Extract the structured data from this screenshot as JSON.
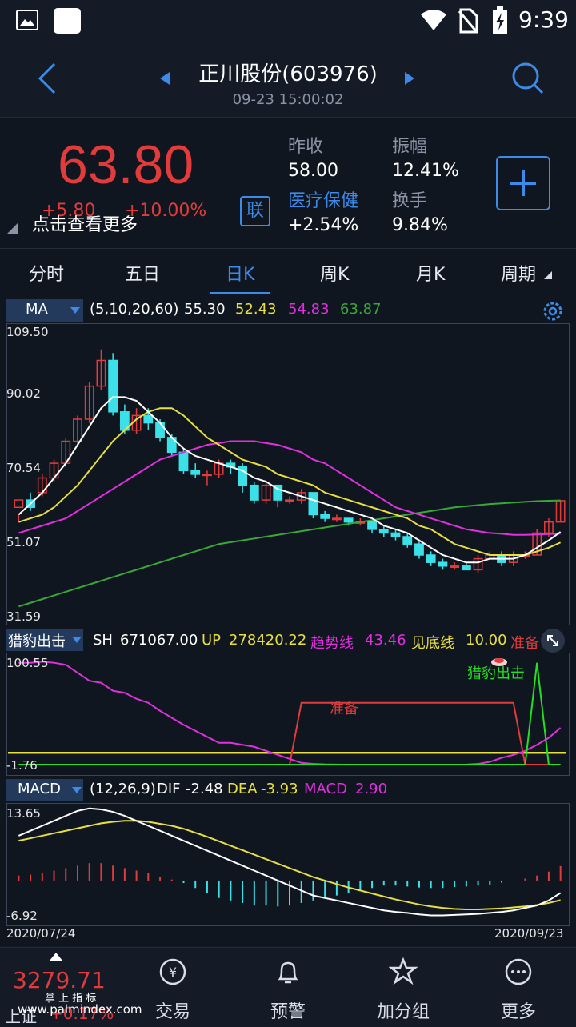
{
  "status": {
    "time": "9:39"
  },
  "header": {
    "title": "正川股份(603976)",
    "datetime": "09-23 15:00:02"
  },
  "quote": {
    "price": "63.80",
    "change": "+5.80",
    "change_pct": "+10.00%",
    "more": "点击查看更多",
    "link_badge": "联",
    "prev_close_label": "昨收",
    "prev_close": "58.00",
    "amplitude_label": "振幅",
    "amplitude": "12.41%",
    "sector_label": "医疗保健",
    "sector_change": "+2.54%",
    "turnover_label": "换手",
    "turnover": "9.84%",
    "add_label": "+"
  },
  "tabs": [
    "分时",
    "五日",
    "日K",
    "周K",
    "月K",
    "周期"
  ],
  "ma_legend": {
    "name": "MA",
    "params": "(5,10,20,60)",
    "ma5": "55.30",
    "ma10": "52.43",
    "ma20": "54.83",
    "ma60": "63.87"
  },
  "price_axis": [
    "109.50",
    "90.02",
    "70.54",
    "51.07",
    "31.59"
  ],
  "ind_legend": {
    "name": "猎豹出击",
    "sh_label": "SH",
    "sh": "671067.00",
    "up_label": "UP",
    "up": "278420.22",
    "trend_label": "趋势线",
    "trend": "43.46",
    "bottom_label": "见底线",
    "bottom": "10.00",
    "ready_label": "准备"
  },
  "ind_axis": [
    "100.55",
    "-1.76"
  ],
  "ind_annot": {
    "ready": "准备",
    "attack": "猎豹出击"
  },
  "macd_legend": {
    "name": "MACD",
    "params": "(12,26,9)",
    "dif_label": "DIF",
    "dif": "-2.48",
    "dea_label": "DEA",
    "dea": "-3.93",
    "macd_label": "MACD",
    "macd": "2.90"
  },
  "macd_axis": [
    "13.65",
    "-6.92"
  ],
  "dates": {
    "start": "2020/07/24",
    "end": "2020/09/23"
  },
  "bottom": {
    "index_value": "3279.71",
    "index_name": "上证",
    "index_change": "+0.17%",
    "nav": [
      "交易",
      "预警",
      "加分组",
      "更多"
    ],
    "watermark": "www.palmindex.com",
    "wm_label": "掌 上 指 标"
  },
  "colors": {
    "up": "#e23b3b",
    "down": "#3be0e8",
    "accent": "#3d8ae8",
    "ma5": "#ffffff",
    "ma10": "#e8e040",
    "ma20": "#e030e0",
    "ma60": "#3aa838"
  },
  "chart_data": {
    "type": "candlestick",
    "ylim": [
      31.59,
      109.5
    ],
    "candles": [
      [
        62,
        64,
        60,
        58
      ],
      [
        64,
        62,
        66,
        61
      ],
      [
        66,
        70,
        71,
        65
      ],
      [
        70,
        74,
        75,
        69
      ],
      [
        74,
        80,
        81,
        73
      ],
      [
        80,
        86,
        87,
        79
      ],
      [
        86,
        95,
        96,
        85
      ],
      [
        95,
        102,
        105,
        94
      ],
      [
        102,
        88,
        104,
        87
      ],
      [
        88,
        83,
        90,
        82
      ],
      [
        83,
        87,
        89,
        82
      ],
      [
        87,
        85,
        89,
        83
      ],
      [
        85,
        81,
        86,
        80
      ],
      [
        81,
        77,
        82,
        76
      ],
      [
        77,
        72,
        78,
        71
      ],
      [
        72,
        71,
        74,
        70
      ],
      [
        71,
        71,
        72,
        68
      ],
      [
        71,
        74,
        75,
        70
      ],
      [
        74,
        73,
        75,
        71
      ],
      [
        73,
        68,
        74,
        66
      ],
      [
        68,
        64,
        69,
        63
      ],
      [
        64,
        68,
        69,
        63
      ],
      [
        68,
        64,
        68,
        62
      ],
      [
        64,
        64,
        65,
        63
      ],
      [
        64,
        66,
        67,
        63
      ],
      [
        66,
        60,
        66,
        59
      ],
      [
        60,
        59,
        61,
        58
      ],
      [
        59,
        59,
        60,
        58
      ],
      [
        59,
        58,
        59,
        57
      ],
      [
        58,
        58,
        59,
        57
      ],
      [
        58,
        56,
        58,
        55
      ],
      [
        56,
        55,
        57,
        54
      ],
      [
        55,
        54,
        56,
        53
      ],
      [
        54,
        52,
        55,
        51
      ],
      [
        52,
        49,
        53,
        48
      ],
      [
        49,
        47,
        50,
        46
      ],
      [
        47,
        46,
        48,
        45
      ],
      [
        46,
        46,
        47,
        45
      ],
      [
        46,
        45,
        47,
        45
      ],
      [
        45,
        48,
        49,
        44
      ],
      [
        48,
        49,
        50,
        48
      ],
      [
        49,
        47,
        50,
        46
      ],
      [
        47,
        49,
        50,
        46
      ],
      [
        49,
        49,
        50,
        48
      ],
      [
        49,
        55,
        56,
        49
      ],
      [
        55,
        58,
        59,
        54
      ],
      [
        58,
        63.8,
        64,
        58
      ]
    ],
    "ma5": [
      60,
      63,
      66,
      70,
      74,
      79,
      84,
      89,
      92,
      92,
      91,
      88,
      85,
      81,
      78,
      76,
      75,
      74,
      73,
      72,
      70,
      69,
      67,
      66,
      65,
      64,
      63,
      62,
      61,
      60,
      59,
      57,
      56,
      55,
      53,
      51,
      49,
      48,
      47,
      47,
      48,
      48,
      48,
      49,
      51,
      53,
      55.3
    ],
    "ma10": [
      58,
      59,
      60,
      62,
      65,
      68,
      72,
      76,
      80,
      83,
      86,
      88,
      89,
      89,
      87,
      84,
      81,
      79,
      77,
      75,
      74,
      73,
      71,
      70,
      69,
      68,
      66,
      65,
      64,
      63,
      62,
      61,
      60,
      59,
      57,
      56,
      54,
      52,
      51,
      50,
      49,
      49,
      49,
      49,
      50,
      51,
      52.43
    ],
    "ma20": [
      55,
      56,
      57,
      58,
      59,
      61,
      63,
      65,
      67,
      69,
      71,
      73,
      75,
      76,
      77,
      78,
      79,
      79.5,
      80,
      80,
      80,
      79.5,
      79,
      78,
      77,
      75,
      74,
      72,
      70,
      68,
      66,
      64,
      62,
      61,
      60,
      59,
      58,
      57,
      56,
      55.5,
      55,
      54.8,
      54.5,
      54.5,
      54.6,
      54.7,
      54.83
    ],
    "ma60": [
      35,
      36,
      37,
      38,
      39,
      40,
      41,
      42,
      43,
      44,
      45,
      46,
      47,
      48,
      49,
      50,
      51,
      52,
      52.5,
      53,
      53.5,
      54,
      54.5,
      55,
      55.5,
      56,
      56.5,
      57,
      57.5,
      58,
      58.5,
      59,
      59.5,
      60,
      60.5,
      61,
      61.5,
      62,
      62.3,
      62.6,
      62.9,
      63.1,
      63.3,
      63.5,
      63.7,
      63.8,
      63.87
    ]
  }
}
